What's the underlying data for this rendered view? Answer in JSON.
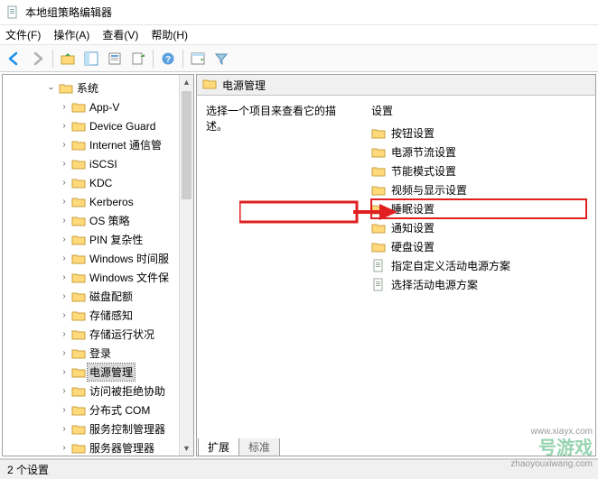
{
  "window": {
    "title": "本地组策略编辑器"
  },
  "menu": {
    "file": "文件(F)",
    "action": "操作(A)",
    "view": "查看(V)",
    "help": "帮助(H)"
  },
  "toolbar_icons": {
    "back": "back-arrow",
    "forward": "forward-arrow",
    "up": "up-folder",
    "console": "console-tree",
    "properties": "properties",
    "export": "export-list",
    "help": "help",
    "show": "show-hide",
    "filter": "filter"
  },
  "tree": {
    "root": "系统",
    "children": [
      "App-V",
      "Device Guard",
      "Internet 通信管",
      "iSCSI",
      "KDC",
      "Kerberos",
      "OS 策略",
      "PIN 复杂性",
      "Windows 时间服",
      "Windows 文件保",
      "磁盘配额",
      "存储感知",
      "存储运行状况",
      "登录",
      "电源管理",
      "访问被拒绝协助",
      "分布式 COM",
      "服务控制管理器",
      "服务器管理器"
    ],
    "selected_index": 14
  },
  "detail": {
    "heading": "电源管理",
    "description_prompt": "选择一个项目来查看它的描述。",
    "settings_header": "设置",
    "items": [
      {
        "type": "folder",
        "label": "按钮设置"
      },
      {
        "type": "folder",
        "label": "电源节流设置"
      },
      {
        "type": "folder",
        "label": "节能模式设置"
      },
      {
        "type": "folder",
        "label": "视频与显示设置"
      },
      {
        "type": "folder",
        "label": "睡眠设置",
        "highlight": true
      },
      {
        "type": "folder",
        "label": "通知设置"
      },
      {
        "type": "folder",
        "label": "硬盘设置"
      },
      {
        "type": "policy",
        "label": "指定自定义活动电源方案"
      },
      {
        "type": "policy",
        "label": "选择活动电源方案"
      }
    ]
  },
  "tabs": {
    "extended": "扩展",
    "standard": "标准"
  },
  "status": {
    "text": "2 个设置"
  },
  "watermark": {
    "line1": "www.xiayx.com",
    "line2": "号游戏",
    "line3": "zhaoyouxiwang.com"
  }
}
